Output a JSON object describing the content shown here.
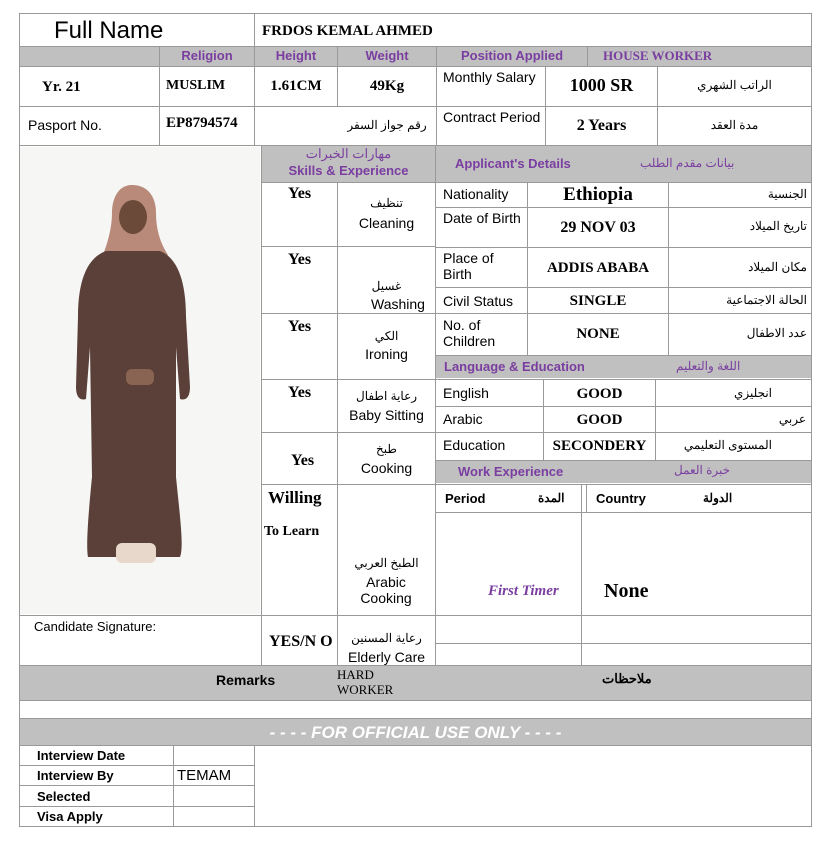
{
  "header": {
    "full_name_label": "Full Name",
    "full_name_value": "FRDOS KEMAL AHMED",
    "religion_label": "Religion",
    "height_label": "Height",
    "weight_label": "Weight",
    "position_label": "Position Applied",
    "position_value": "HOUSE WORKER"
  },
  "row1": {
    "age": "Yr. 21",
    "religion": "MUSLIM",
    "height": "1.61CM",
    "weight": "49Kg",
    "salary_label": "Monthly Salary",
    "salary_value": "1000 SR",
    "salary_ar": "الراتب الشهري"
  },
  "row2": {
    "passport_label": "Pasport No.",
    "passport_value": "EP8794574",
    "passport_ar": "رقم جواز السفر",
    "contract_label": "Contract Period",
    "contract_value": "2 Years",
    "contract_ar": "مدة العقد"
  },
  "skills": {
    "title_ar": "مهارات الخبرات",
    "title_en": "Skills & Experience",
    "items": [
      {
        "answer": "Yes",
        "ar": "تنظيف",
        "en": "Cleaning"
      },
      {
        "answer": "Yes",
        "ar": "غسيل",
        "en": "Washing"
      },
      {
        "answer": "Yes",
        "ar": "الكي",
        "en": "Ironing"
      },
      {
        "answer": "Yes",
        "ar": "رعاية اطفال",
        "en": "Baby Sitting"
      },
      {
        "answer": "Yes",
        "ar": "طبخ",
        "en": "Cooking"
      },
      {
        "answer1": "Willing",
        "answer2": "To Learn",
        "ar": "الطبخ العربي",
        "en": "Arabic Cooking"
      },
      {
        "answer": "YES/N O",
        "ar": "رعاية المسنين",
        "en": "Elderly Care"
      }
    ]
  },
  "details": {
    "title_en": "Applicant's Details",
    "title_ar": "بيانات مقدم الطلب",
    "rows": [
      {
        "label": "Nationality",
        "value": "Ethiopia",
        "ar": "الجنسية"
      },
      {
        "label": "Date of Birth",
        "value": "29 NOV 03",
        "ar": "تاريخ الميلاد"
      },
      {
        "label": "Place of Birth",
        "value": "ADDIS ABABA",
        "ar": "مكان الميلاد"
      },
      {
        "label": "Civil Status",
        "value": "SINGLE",
        "ar": "الحالة الاجتماعية"
      },
      {
        "label": "No. of Children",
        "value": "NONE",
        "ar": "عدد الاطفال"
      }
    ]
  },
  "language": {
    "title_en": "Language & Education",
    "title_ar": "اللغة والتعليم",
    "rows": [
      {
        "label": "English",
        "value": "GOOD",
        "ar": "انجليزي"
      },
      {
        "label": "Arabic",
        "value": "GOOD",
        "ar": "عربي"
      },
      {
        "label": "Education",
        "value": "SECONDERY",
        "ar": "المستوى التعليمي"
      }
    ]
  },
  "work": {
    "title_en": "Work Experience",
    "title_ar": "خبرة العمل",
    "period_label": "Period",
    "period_ar": "المدة",
    "country_label": "Country",
    "country_ar": "الدولة",
    "period_value": "First Timer",
    "country_value": "None"
  },
  "signature_label": "Candidate Signature:",
  "remarks": {
    "label": "Remarks",
    "value": "HARD WORKER",
    "ar": "ملاحظات"
  },
  "official": {
    "banner": "- - - - FOR OFFICIAL USE ONLY - - - -",
    "rows": [
      {
        "label": "Interview Date",
        "value": ""
      },
      {
        "label": "Interview By",
        "value": "TEMAM"
      },
      {
        "label": "Selected",
        "value": ""
      },
      {
        "label": "Visa Apply",
        "value": ""
      }
    ]
  },
  "colors": {
    "purple": "#7a3ea0",
    "gray": "#c0c0c0"
  }
}
